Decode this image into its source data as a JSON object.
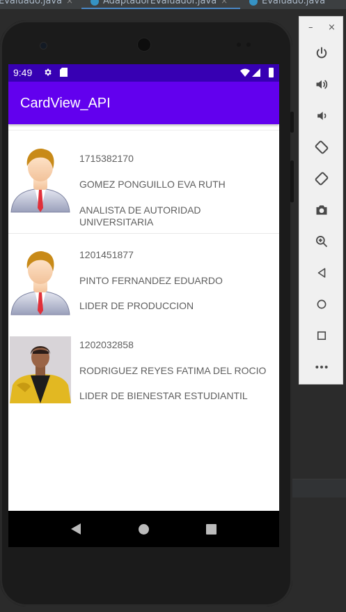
{
  "ide": {
    "tabs": [
      {
        "label": "Evaluado.java",
        "close": "×"
      },
      {
        "label": "AdaptadorEvaluador.java",
        "close": "×"
      },
      {
        "label": "Evaluado.java",
        "close": ""
      }
    ]
  },
  "status_bar": {
    "time": "9:49",
    "icons": [
      "gear-icon",
      "sd-card-icon",
      "wifi-icon",
      "signal-icon",
      "battery-icon"
    ]
  },
  "app_bar": {
    "title": "CardView_API",
    "color": "#6200ee",
    "status_color": "#3700b3"
  },
  "cards": [
    {
      "id": "1715382170",
      "name": "GOMEZ PONGUILLO EVA RUTH",
      "role": "ANALISTA DE AUTORIDAD UNIVERSITARIA",
      "avatar": "default-man-avatar"
    },
    {
      "id": "1201451877",
      "name": "PINTO FERNANDEZ EDUARDO",
      "role": "LIDER DE PRODUCCION",
      "avatar": "default-man-avatar"
    },
    {
      "id": "1202032858",
      "name": "RODRIGUEZ REYES FATIMA DEL ROCIO",
      "role": "LIDER DE BIENESTAR ESTUDIANTIL",
      "avatar": "person-photo"
    }
  ],
  "nav_bar": {
    "buttons": [
      "back-icon",
      "home-icon",
      "recents-icon"
    ]
  },
  "emulator_toolbar": {
    "window_controls": [
      "minimize-icon",
      "close-icon"
    ],
    "buttons": [
      "power-icon",
      "volume-up-icon",
      "volume-down-icon",
      "rotate-left-icon",
      "rotate-right-icon",
      "camera-icon",
      "zoom-icon",
      "back-icon",
      "home-icon",
      "overview-icon",
      "more-icon"
    ]
  }
}
